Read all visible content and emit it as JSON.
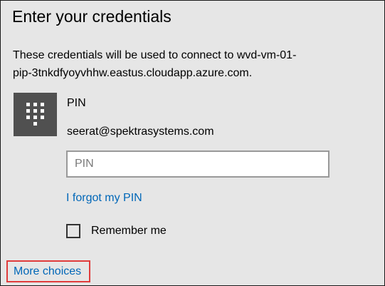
{
  "dialog": {
    "title": "Enter your credentials",
    "message_line1": "These credentials will be used to connect to wvd-vm-01-",
    "message_line2": "pip-3tnkdfyoyvhhw.eastus.cloudapp.azure.com."
  },
  "credential": {
    "icon": "pin-keypad-icon",
    "type_label": "PIN",
    "username": "seerat@spektrasystems.com",
    "pin_value": "",
    "pin_placeholder": "PIN",
    "forgot_pin_label": "I forgot my PIN",
    "remember_me_label": "Remember me",
    "remember_me_checked": false
  },
  "footer": {
    "more_choices_label": "More choices"
  },
  "colors": {
    "background": "#e6e6e6",
    "link": "#0067b8",
    "highlight_border": "#e03c3c",
    "tile": "#505050"
  }
}
